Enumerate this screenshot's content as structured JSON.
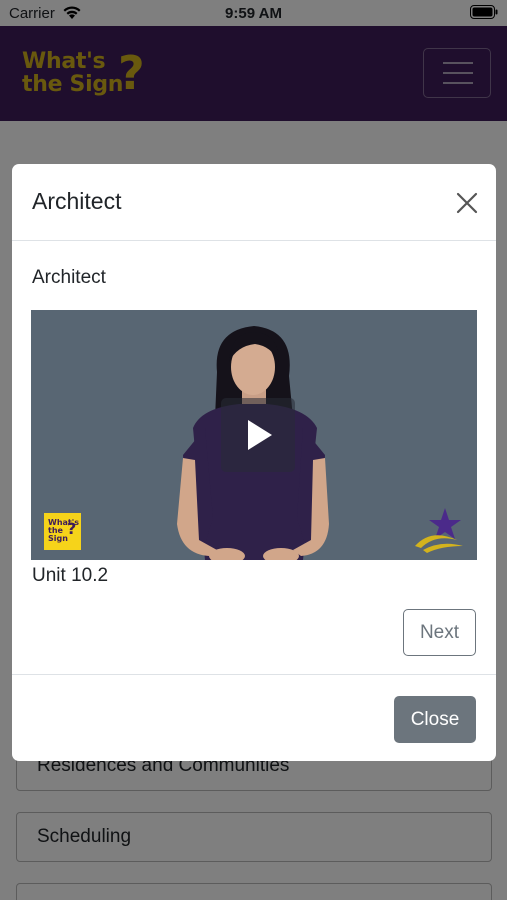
{
  "status_bar": {
    "carrier": "Carrier",
    "time": "9:59 AM"
  },
  "header": {
    "logo_line1": "What's",
    "logo_line2": "the Sign",
    "logo_mark": "?",
    "menu_icon": "hamburger-icon"
  },
  "list": {
    "items": [
      {
        "label": "Residences and Communities"
      },
      {
        "label": "Scheduling"
      },
      {
        "label": ""
      }
    ]
  },
  "modal": {
    "title": "Architect",
    "close_icon": "close-icon",
    "sign_word": "Architect",
    "video": {
      "play_icon": "play-icon",
      "logo_line1": "What's",
      "logo_line2": "the",
      "logo_line3": "Sign",
      "logo_mark": "?",
      "corner_logo": "star-swoosh-logo"
    },
    "unit": "Unit 10.2",
    "next_label": "Next",
    "close_label": "Close"
  },
  "colors": {
    "header_bg": "#3e1c5a",
    "logo_gold": "#d3b31d",
    "video_bg": "#586673",
    "close_button": "#6c757d"
  }
}
